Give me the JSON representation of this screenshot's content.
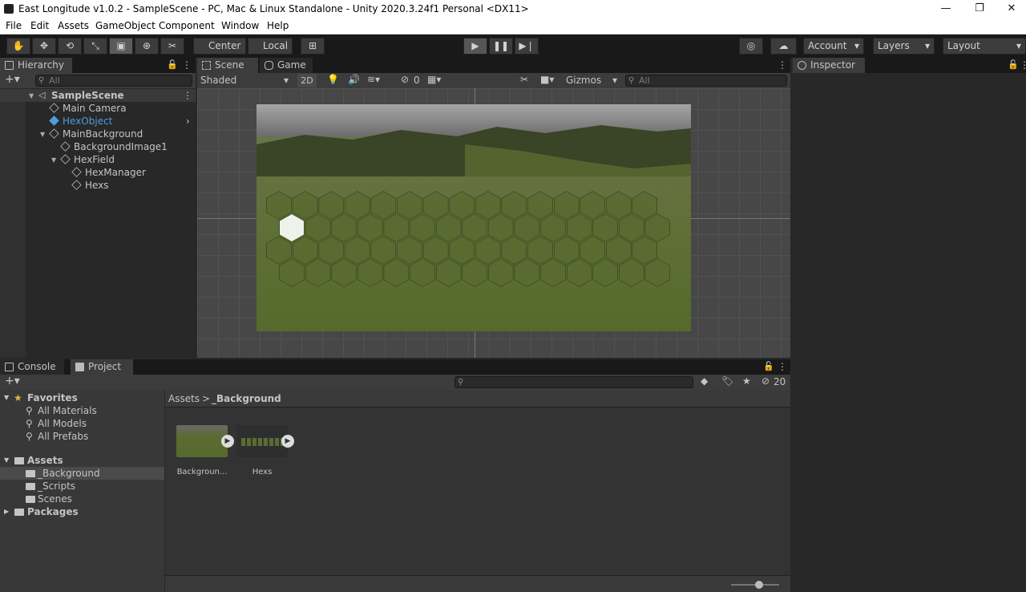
{
  "window": {
    "title": "East Longitude v1.0.2 - SampleScene - PC, Mac & Linux Standalone - Unity 2020.3.24f1 Personal <DX11>"
  },
  "menu": [
    "File",
    "Edit",
    "Assets",
    "GameObject",
    "Component",
    "Window",
    "Help"
  ],
  "toolbar": {
    "pivot": "Center",
    "space": "Local",
    "account": "Account",
    "layers": "Layers",
    "layout": "Layout"
  },
  "hierarchy": {
    "tab": "Hierarchy",
    "search_placeholder": "All",
    "items": [
      {
        "label": "SampleScene",
        "depth": 0
      },
      {
        "label": "Main Camera",
        "depth": 1
      },
      {
        "label": "HexObject",
        "depth": 1
      },
      {
        "label": "MainBackground",
        "depth": 1
      },
      {
        "label": "BackgroundImage1",
        "depth": 2
      },
      {
        "label": "HexField",
        "depth": 2
      },
      {
        "label": "HexManager",
        "depth": 3
      },
      {
        "label": "Hexs",
        "depth": 3
      }
    ]
  },
  "scene": {
    "tab_scene": "Scene",
    "tab_game": "Game",
    "shading": "Shaded",
    "mode_2d": "2D",
    "hidden_count": "0",
    "gizmos": "Gizmos",
    "search_placeholder": "All"
  },
  "inspector": {
    "tab": "Inspector"
  },
  "bottom": {
    "tab_console": "Console",
    "tab_project": "Project",
    "visible_count": "20",
    "breadcrumb_root": "Assets",
    "breadcrumb_sep": ">",
    "breadcrumb_current": "_Background",
    "favorites_label": "Favorites",
    "favorites": [
      "All Materials",
      "All Models",
      "All Prefabs"
    ],
    "assets_label": "Assets",
    "asset_folders": [
      "_Background",
      "_Scripts",
      "Scenes"
    ],
    "packages_label": "Packages",
    "asset_items": [
      "Backgroun...",
      "Hexs"
    ]
  },
  "colors": {
    "selection_text": "#4d9de0",
    "accent_star": "#e3b341"
  }
}
